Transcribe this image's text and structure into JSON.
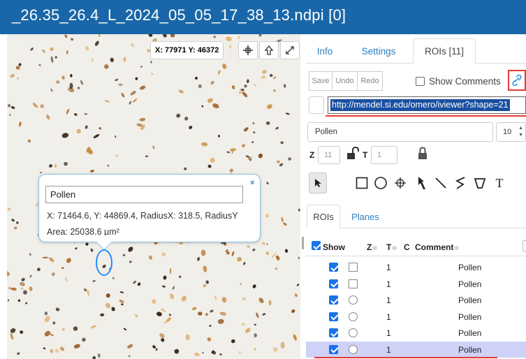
{
  "window": {
    "title": "_26.35_26.4_L_2024_05_05_17_38_13.ndpi [0]"
  },
  "viewer": {
    "coordinates": "X: 77971 Y: 46372",
    "buttons": {
      "crosshair": "crosshair-icon",
      "upload": "arrow-up-icon",
      "fullscreen": "expand-icon"
    },
    "popup": {
      "text_value": "Pollen",
      "coords_line": "X: 71464.6, Y: 44869.4, RadiusX: 318.5, RadiusY",
      "area_line": "Area: 25038.6 µm²",
      "close_label": "×"
    }
  },
  "panel": {
    "tabs": [
      {
        "label": "Info"
      },
      {
        "label": "Settings"
      },
      {
        "label": "ROIs [11]",
        "active": true
      }
    ],
    "toolbar": {
      "save_label": "Save",
      "undo_label": "Undo",
      "redo_label": "Redo",
      "show_comments_label": "Show Comments",
      "show_comments_checked": false,
      "link_icon": "link-icon"
    },
    "share_url": "http://mendel.si.edu/omero/iviewer?shape=21",
    "roi_text": "Pollen",
    "font_size": "10",
    "z_label": "Z",
    "z_value": "11",
    "t_label": "T",
    "t_value": "1",
    "draw_tools": [
      "pointer-icon",
      "rectangle-icon",
      "ellipse-icon",
      "point-icon",
      "arrow-icon",
      "line-icon",
      "polyline-icon",
      "polygon-icon",
      "text-icon"
    ],
    "text_tool_label": "T",
    "subtabs": [
      {
        "label": "ROIs",
        "active": true
      },
      {
        "label": "Planes"
      }
    ],
    "table": {
      "show_label": "Show",
      "z_header": "Z",
      "t_header": "T",
      "c_header": "C",
      "comment_header": "Comment",
      "sort_glyph": "≑",
      "rows": [
        {
          "shape": "rectangle",
          "z": "1",
          "comment": "Pollen",
          "selected": false
        },
        {
          "shape": "rectangle",
          "z": "1",
          "comment": "Pollen",
          "selected": false
        },
        {
          "shape": "ellipse",
          "z": "1",
          "comment": "Pollen",
          "selected": false
        },
        {
          "shape": "ellipse",
          "z": "1",
          "comment": "Pollen",
          "selected": false
        },
        {
          "shape": "ellipse",
          "z": "1",
          "comment": "Pollen",
          "selected": false
        },
        {
          "shape": "ellipse",
          "z": "1",
          "comment": "Pollen",
          "selected": true
        }
      ]
    }
  },
  "colors": {
    "titlebar": "#1967a8",
    "accent_link": "#2c7fc1",
    "highlight": "#e53935",
    "selection_row": "#cfd1f6",
    "roi_outline": "#1e90ff"
  }
}
